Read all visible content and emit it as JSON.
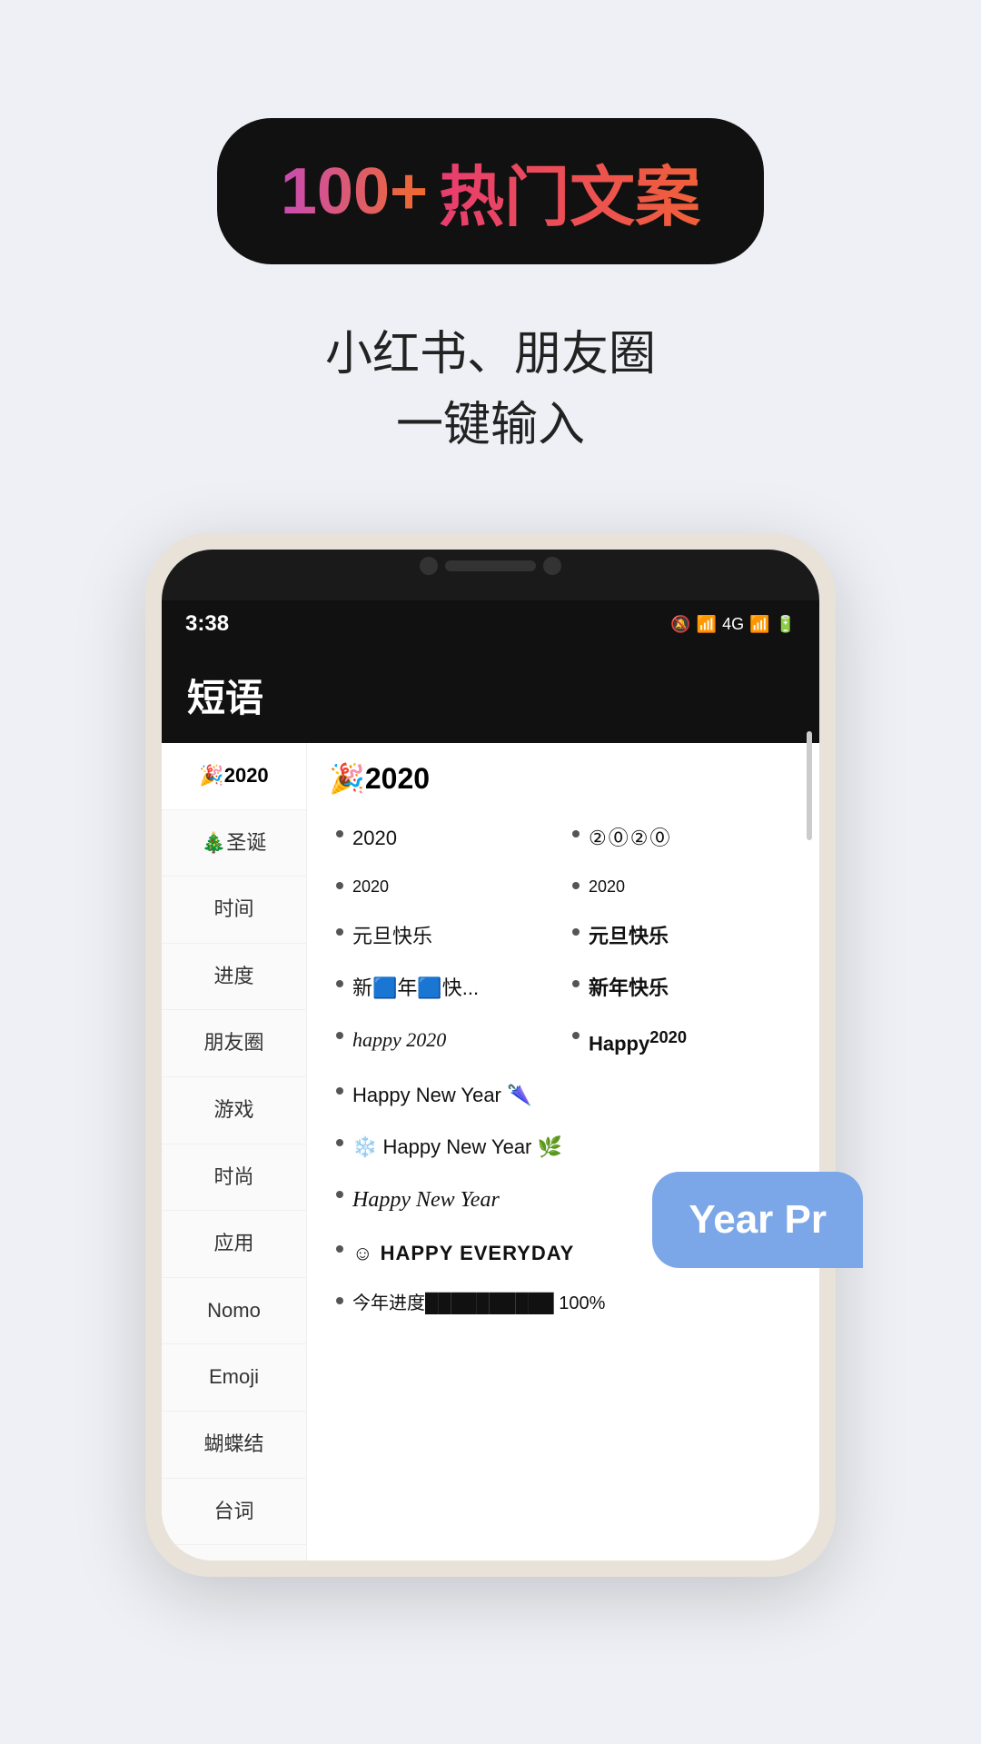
{
  "badge": {
    "prefix": "100+",
    "text": "热门文案"
  },
  "subtitle": {
    "line1": "小红书、朋友圈",
    "line2": "一键输入"
  },
  "phone": {
    "time": "3:38",
    "status_icons": "🔕 📶 4G 📶 🔋",
    "app_title": "短语",
    "sidebar": [
      {
        "label": "🎉2020",
        "active": true
      },
      {
        "label": "🎄圣诞"
      },
      {
        "label": "时间"
      },
      {
        "label": "进度"
      },
      {
        "label": "朋友圈"
      },
      {
        "label": "游戏"
      },
      {
        "label": "时尚"
      },
      {
        "label": "应用"
      },
      {
        "label": "Nomo"
      },
      {
        "label": "Emoji"
      },
      {
        "label": "蝴蝶结"
      },
      {
        "label": "台词"
      }
    ],
    "section_title": "🎉2020",
    "items": [
      {
        "text": "2020",
        "style": "normal",
        "col": 1
      },
      {
        "text": "②⓪②⓪",
        "style": "circled",
        "col": 2
      },
      {
        "text": "2020",
        "style": "small",
        "col": 1
      },
      {
        "text": "2020",
        "style": "small",
        "col": 2
      },
      {
        "text": "元旦快乐",
        "style": "normal",
        "col": 1
      },
      {
        "text": "元旦快乐",
        "style": "bold",
        "col": 2
      },
      {
        "text": "新🟦年🟦快...",
        "style": "normal",
        "col": 1
      },
      {
        "text": "新年快乐",
        "style": "bold",
        "col": 2
      },
      {
        "text": "happy 2020",
        "style": "cursive",
        "col": 1
      },
      {
        "text": "Happy²⁰²⁰",
        "style": "bold",
        "col": 2
      },
      {
        "text": "Happy New Year 🌂",
        "style": "normal",
        "col": "full"
      },
      {
        "text": "❄️ Happy New Year 🌿",
        "style": "normal",
        "col": "full"
      },
      {
        "text": "Happy New Year",
        "style": "script",
        "col": "full"
      },
      {
        "text": "☺ HAPPY EVERYDAY",
        "style": "caps",
        "col": "full"
      },
      {
        "text": "今年进度██████████ 100%",
        "style": "normal",
        "col": "full"
      }
    ],
    "tooltip": "Year Pr"
  }
}
